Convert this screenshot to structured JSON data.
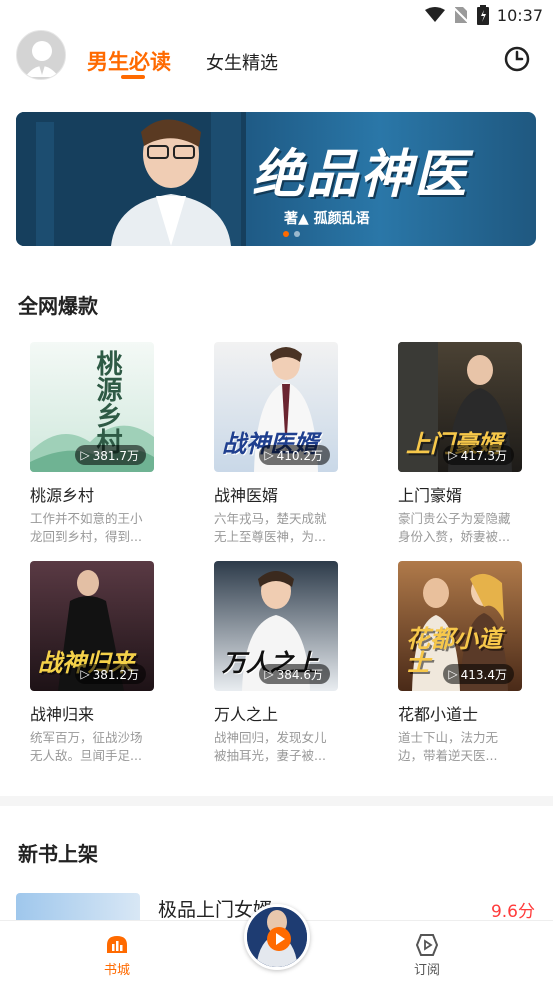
{
  "status_bar": {
    "time": "10:37"
  },
  "header": {
    "tabs": [
      {
        "label": "男生必读",
        "active": true
      },
      {
        "label": "女生精选",
        "active": false
      }
    ]
  },
  "banner": {
    "title": "绝品神医",
    "author": "著▲ 孤颜乱语"
  },
  "sections": {
    "hot": {
      "title": "全网爆款",
      "books": [
        {
          "name": "桃源乡村",
          "plays": "381.7万",
          "cover_text": "桃源乡村",
          "desc": "工作并不如意的王小龙回到乡村，得到...",
          "cover_color": "#dff0e8"
        },
        {
          "name": "战神医婿",
          "plays": "410.2万",
          "cover_text": "战神医婿",
          "desc": "六年戎马，楚天成就无上至尊医神，为...",
          "cover_color": "#d6e4f2"
        },
        {
          "name": "上门豪婿",
          "plays": "417.3万",
          "cover_text": "上门豪婿",
          "desc": "豪门贵公子为爱隐藏身份入赘，娇妻被...",
          "cover_color": "#3a3024"
        },
        {
          "name": "战神归来",
          "plays": "381.2万",
          "cover_text": "战神归来",
          "desc": "统军百万，征战沙场无人敌。旦闻手足...",
          "cover_color": "#4a2f38"
        },
        {
          "name": "万人之上",
          "plays": "384.6万",
          "cover_text": "万人之上",
          "desc": "战神回归，发现女儿被抽耳光，妻子被...",
          "cover_color": "#2f3a46"
        },
        {
          "name": "花都小道士",
          "plays": "413.4万",
          "cover_text": "花都小道士",
          "desc": "道士下山，法力无边，带着逆天医...",
          "cover_color": "#7a4a2a"
        }
      ]
    },
    "new": {
      "title": "新书上架",
      "book": {
        "name": "极品上门女婿",
        "score": "9.6分"
      }
    }
  },
  "bottom_nav": {
    "items": [
      {
        "label": "书城",
        "active": true
      },
      {
        "label": "订阅",
        "active": false
      }
    ]
  },
  "colors": {
    "accent": "#ff6a00",
    "score": "#ff3b3b",
    "banner": "#1f5b86"
  }
}
